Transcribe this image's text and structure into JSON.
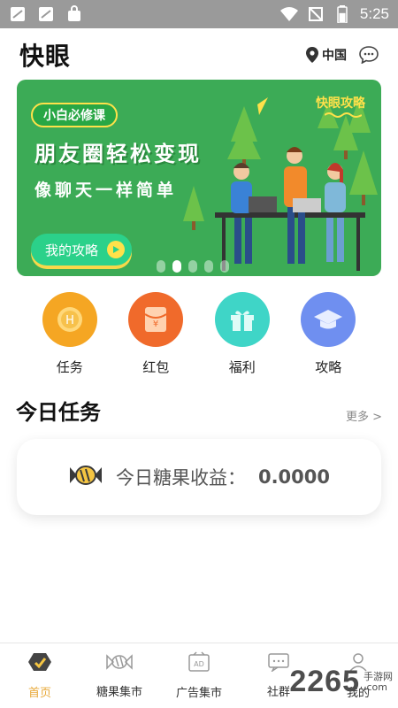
{
  "status_bar": {
    "time": "5:25",
    "battery_level": 0.6,
    "icons": [
      "notification-icon",
      "notification-icon",
      "shopping-bag-icon",
      "wifi-icon",
      "no-sim-icon",
      "battery-icon"
    ]
  },
  "header": {
    "title": "快眼",
    "location": "中国"
  },
  "banner": {
    "tag": "小白必修课",
    "brand": "快眼攻略",
    "headline": "朋友圈轻松变现",
    "subline": "像聊天一样简单",
    "cta": "我的攻略",
    "dots_count": 5,
    "active_dot": 1,
    "bg_color": "#3cab56"
  },
  "menu": {
    "items": [
      {
        "label": "任务",
        "icon": "task-coin-icon",
        "color": "#f5a623"
      },
      {
        "label": "红包",
        "icon": "red-envelope-icon",
        "color": "#f06a2b"
      },
      {
        "label": "福利",
        "icon": "gift-icon",
        "color": "#3fd5c7"
      },
      {
        "label": "攻略",
        "icon": "graduation-cap-icon",
        "color": "#6f8ff0"
      }
    ]
  },
  "today": {
    "title": "今日任务",
    "more": "更多 >",
    "earnings_label": "今日糖果收益：",
    "earnings_value": "0.0000",
    "icon": "candy-icon"
  },
  "bottom_nav": {
    "items": [
      {
        "label": "首页",
        "icon": "home-icon",
        "active": true
      },
      {
        "label": "糖果集市",
        "icon": "candy-icon",
        "active": false
      },
      {
        "label": "广告集市",
        "icon": "ad-icon",
        "active": false
      },
      {
        "label": "社群",
        "icon": "chat-icon",
        "active": false
      },
      {
        "label": "我的",
        "icon": "user-icon",
        "active": false
      }
    ],
    "active_color": "#e8a93a"
  },
  "watermark": {
    "number": "2265",
    "suffix_cn": "手游网",
    "suffix_domain": ".com"
  }
}
